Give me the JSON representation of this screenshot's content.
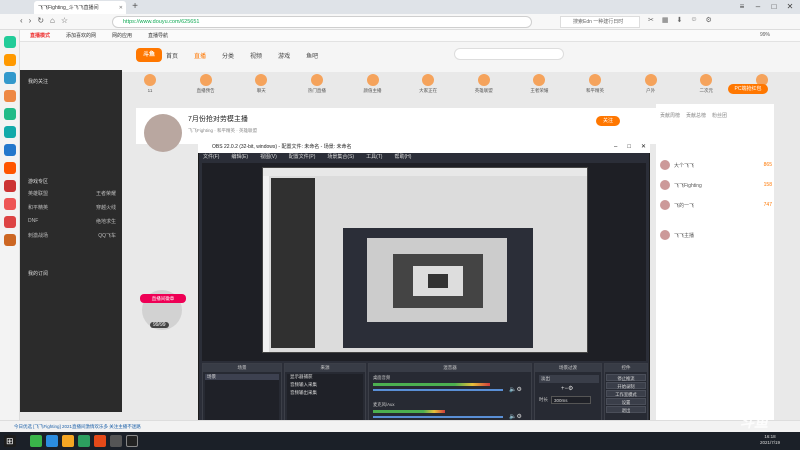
{
  "browser": {
    "tab_title": "飞飞Fighting_斗飞飞直播间",
    "url": "https://www.douyu.com/625651",
    "search_placeholder": "搜索Edn 一种建行日时",
    "bookmarks": [
      "直播模式",
      "添加喜欢的网",
      "网的应用",
      "直播导航"
    ],
    "zoom": "99%"
  },
  "douyu": {
    "nav": [
      "首页",
      "直播",
      "分类",
      "视频",
      "游戏",
      "鱼吧"
    ],
    "categories": [
      "11",
      "直播预告",
      "聊天",
      "热门直播",
      "颜值主播",
      "大家正在",
      "英雄联盟",
      "王者荣耀",
      "和平精英",
      "户外",
      "二次元",
      "全部"
    ],
    "room_title": "7月份抢对劳模主播",
    "room_meta": "飞飞Fighting · 和平精英 · 英雄联盟",
    "follow": "关注",
    "pc_badge": "PC端抢红包",
    "rank_tabs": [
      "贡献周榜",
      "贡献总榜",
      "粉丝团"
    ],
    "ranks": [
      {
        "name": "大个飞飞",
        "value": "865"
      },
      {
        "name": "飞飞Fighting",
        "value": "158"
      },
      {
        "name": "飞的一飞",
        "value": "747"
      },
      {
        "name": "飞飞主播",
        "value": ""
      }
    ],
    "sidebar_heads": [
      "我的关注",
      "游戏专区",
      "我的订阅"
    ],
    "sidebar_rows": [
      [
        "英雄联盟",
        "王者荣耀"
      ],
      [
        "和平精英",
        "穿越火线"
      ],
      [
        "DNF",
        "绝地求生"
      ],
      [
        "刺激战场",
        "QQ飞车"
      ]
    ],
    "badge_label": "直播间徽章",
    "badge_value": "99/99"
  },
  "obs": {
    "title": "OBS 22.0.2 (32-bit, windows) - 配置文件: 未命名 - 场景: 未命名",
    "menu": [
      "文件(F)",
      "编辑(E)",
      "视图(V)",
      "配置文件(P)",
      "场景集合(S)",
      "工具(T)",
      "帮助(H)"
    ],
    "docks": [
      "场景",
      "来源",
      "混音器",
      "场景过渡",
      "控件"
    ],
    "scene_item": "场景",
    "sources": [
      "显示器捕获",
      "音频输入采集",
      "音频输出采集"
    ],
    "mixer": [
      {
        "name": "桌面音频",
        "level": 0.9
      },
      {
        "name": "麦克风/Aux",
        "level": 0.55
      }
    ],
    "transition": "淡出",
    "duration_label": "时长",
    "duration_value": "300ms",
    "controls": [
      "停止推流",
      "开始录制",
      "工作室模式",
      "设置",
      "退出"
    ]
  },
  "status": {
    "text": "今日优选  [飞飞Fighting] 2021直播间激情欢乐多 关注主播不迷路"
  },
  "taskbar": {
    "time": "16:18",
    "date": "2021/7/19"
  },
  "watermark": "斗鱼"
}
